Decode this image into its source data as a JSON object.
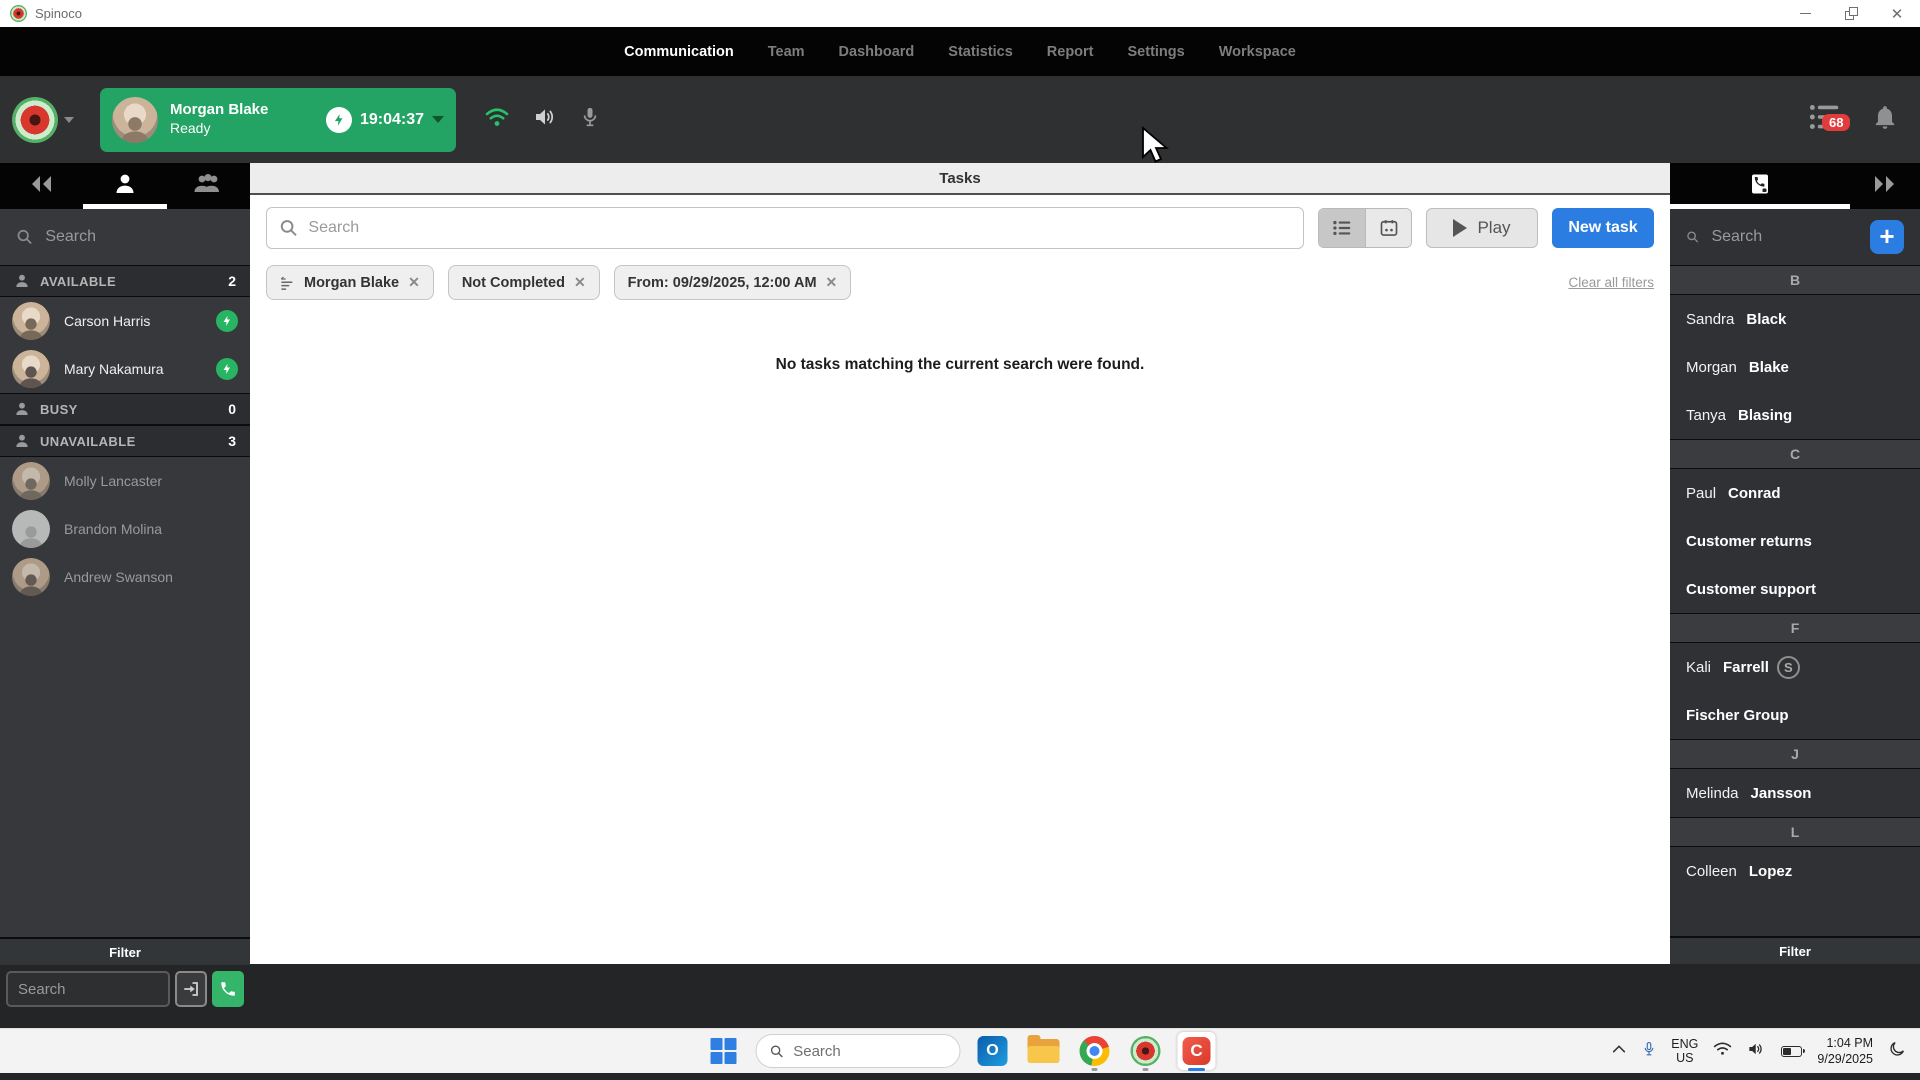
{
  "titlebar": {
    "app_name": "Spinoco"
  },
  "nav": {
    "items": [
      "Communication",
      "Team",
      "Dashboard",
      "Statistics",
      "Report",
      "Settings",
      "Workspace"
    ]
  },
  "header": {
    "user": {
      "name": "Morgan Blake",
      "status": "Ready",
      "timer": "19:04:37"
    },
    "notification_count": "68"
  },
  "left_sidebar": {
    "search_placeholder": "Search",
    "groups": [
      {
        "label": "AVAILABLE",
        "count": "2"
      },
      {
        "label": "BUSY",
        "count": "0"
      },
      {
        "label": "UNAVAILABLE",
        "count": "3"
      }
    ],
    "available_members": [
      {
        "name": "Carson Harris"
      },
      {
        "name": "Mary Nakamura"
      }
    ],
    "unavailable_members": [
      {
        "name": "Molly Lancaster"
      },
      {
        "name": "Brandon Molina"
      },
      {
        "name": "Andrew Swanson"
      }
    ],
    "filter_label": "Filter",
    "dialer_placeholder": "Search"
  },
  "main": {
    "title": "Tasks",
    "search_placeholder": "Search",
    "play_label": "Play",
    "new_task_label": "New task",
    "chips": [
      {
        "label": "Morgan Blake"
      },
      {
        "label": "Not Completed"
      },
      {
        "label": "From: 09/29/2025, 12:00 AM"
      }
    ],
    "close_glyph": "✕",
    "clear_filters_label": "Clear all filters",
    "empty_message": "No tasks matching the current search were found."
  },
  "right_sidebar": {
    "search_placeholder": "Search",
    "sections": [
      {
        "letter": "B",
        "contacts": [
          {
            "first": "Sandra",
            "last": "Black"
          },
          {
            "first": "Morgan",
            "last": "Blake"
          },
          {
            "first": "Tanya",
            "last": "Blasing"
          }
        ]
      },
      {
        "letter": "C",
        "contacts": [
          {
            "first": "Paul",
            "last": "Conrad"
          },
          {
            "first": "",
            "last": "Customer returns"
          },
          {
            "first": "",
            "last": "Customer support"
          }
        ]
      },
      {
        "letter": "F",
        "contacts": [
          {
            "first": "Kali",
            "last": "Farrell",
            "badge": "S"
          },
          {
            "first": "",
            "last": "Fischer Group"
          }
        ]
      },
      {
        "letter": "J",
        "contacts": [
          {
            "first": "Melinda",
            "last": "Jansson"
          }
        ]
      },
      {
        "letter": "L",
        "contacts": [
          {
            "first": "Colleen",
            "last": "Lopez"
          }
        ]
      }
    ],
    "filter_label": "Filter"
  },
  "taskbar": {
    "search_placeholder": "Search",
    "outlook_glyph": "O",
    "camtasia_glyph": "C",
    "tray": {
      "lang_line1": "ENG",
      "lang_line2": "US",
      "time": "1:04 PM",
      "date": "9/29/2025"
    }
  }
}
